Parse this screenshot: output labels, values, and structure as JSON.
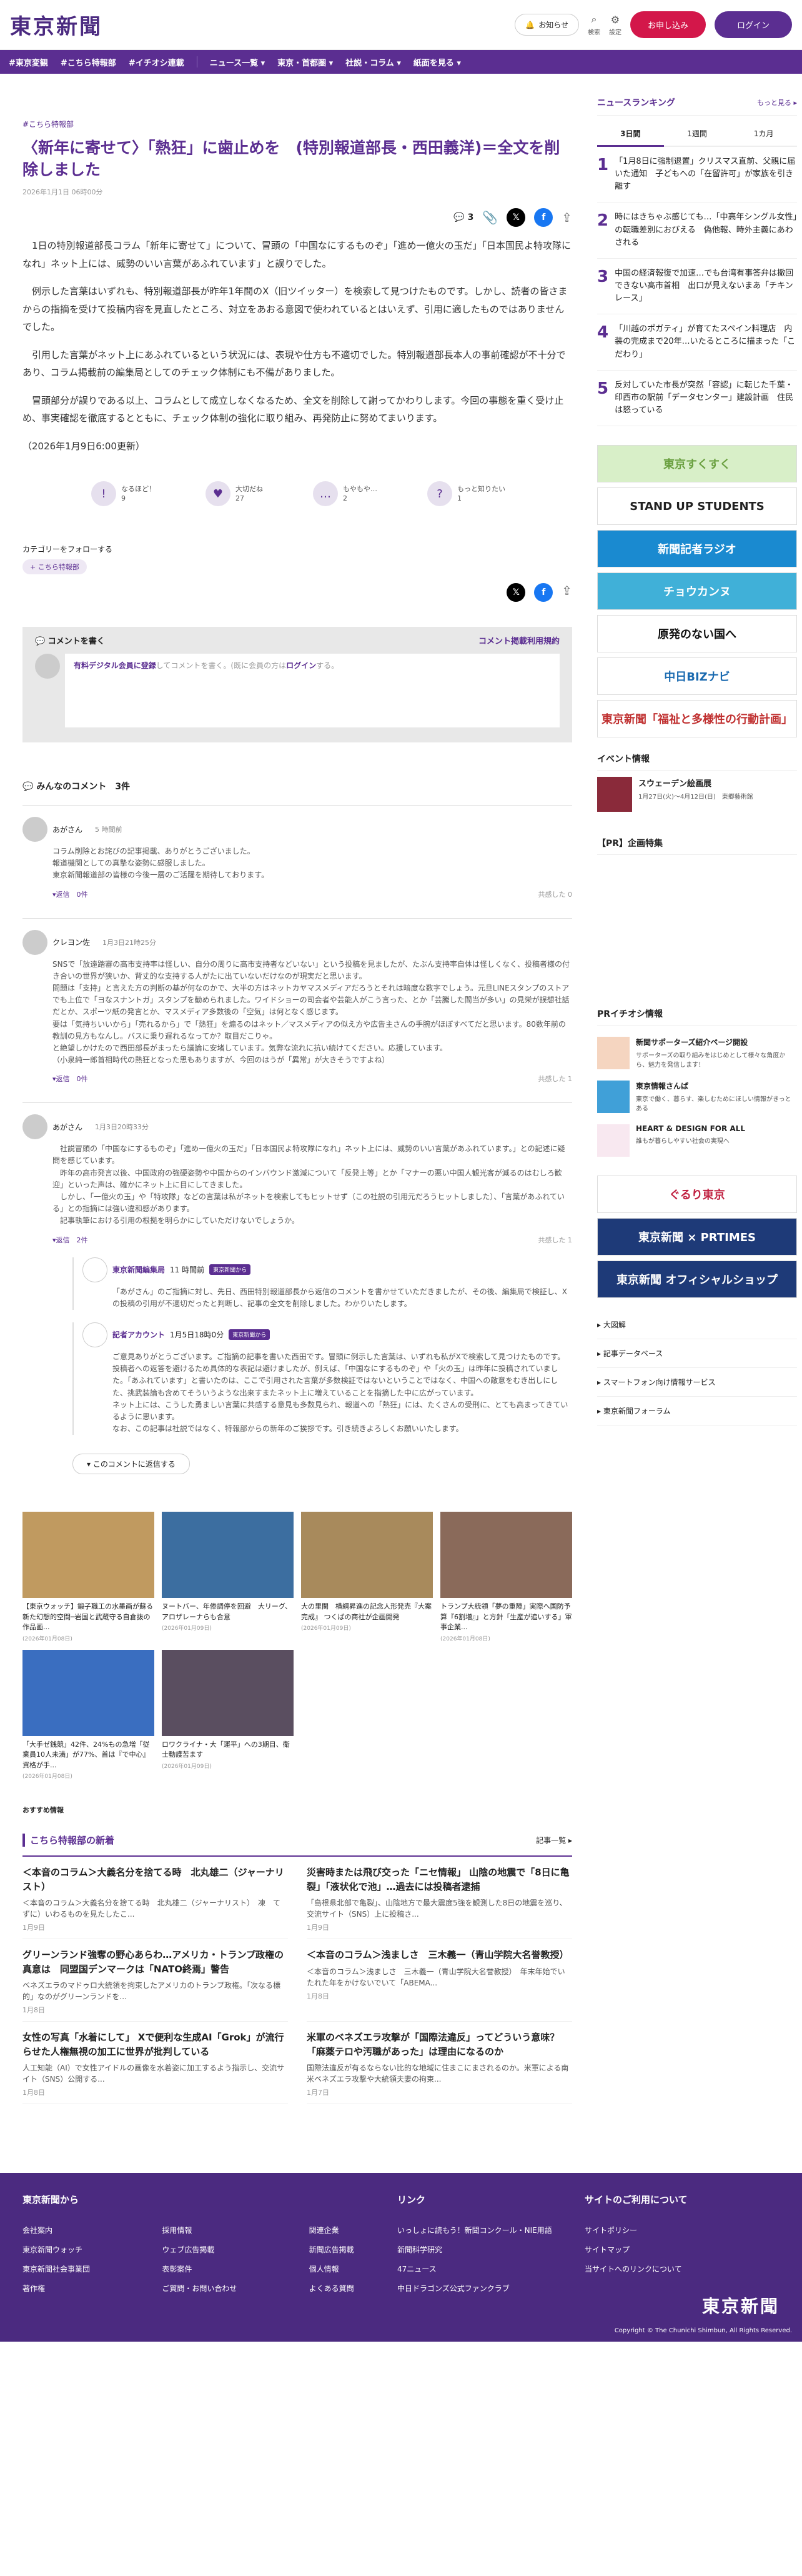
{
  "header": {
    "logo": "東京新聞",
    "notice_label": "お知らせ",
    "search_label": "検索",
    "settings_label": "設定",
    "apply_label": "お申し込み",
    "login_label": "ログイン"
  },
  "nav": [
    "#東京変観",
    "#こちら特報部",
    "#イチオシ連載",
    "ニュース一覧 ▾",
    "東京・首都圏 ▾",
    "社説・コラム ▾",
    "紙面を見る ▾"
  ],
  "article": {
    "breadcrumb": "#こちら特報部",
    "title": "〈新年に寄せて〉「熱狂」に歯止めを　(特別報道部長・西田義洋)＝全文を削除しました",
    "date": "2026年1月1日 06時00分",
    "comment_count": "3",
    "paragraphs": [
      "　1日の特別報道部長コラム「新年に寄せて」について、冒頭の「中国なにするものぞ」「進め一億火の玉だ」「日本国民よ特攻隊になれ」ネット上には、威勢のいい言葉があふれています」と誤りでした。",
      "　例示した言葉はいずれも、特別報道部長が昨年1年間のX（旧ツイッター）を検索して見つけたものです。しかし、読者の皆さまからの指摘を受けて投稿内容を見直したところ、対立をあおる意図で使われているとはいえず、引用に適したものではありませんでした。",
      "　引用した言葉がネット上にあふれているという状況には、表現や仕方も不適切でした。特別報道部長本人の事前確認が不十分であり、コラム掲載前の編集局としてのチェック体制にも不備がありました。",
      "　冒頭部分が誤りである以上、コラムとして成立しなくなるため、全文を削除して謝ってかわりします。今回の事態を重く受け止め、事実確認を徹底するとともに、チェック体制の強化に取り組み、再発防止に努めてまいります。",
      "（2026年1月9日6:00更新）"
    ]
  },
  "reactions": [
    {
      "label": "なるほど！",
      "count": "9"
    },
    {
      "label": "大切だね",
      "count": "27"
    },
    {
      "label": "もやもや…",
      "count": "2"
    },
    {
      "label": "もっと知りたい",
      "count": "1"
    }
  ],
  "category": {
    "heading": "カテゴリーをフォローする",
    "tag": "+ こちら特報部"
  },
  "comment_box": {
    "title": "コメントを書く",
    "policy_link": "コメント掲載利用規約",
    "prompt_link": "有料デジタル会員に登録",
    "prompt_text": "してコメントを書く。(既に会員の方は",
    "login_link": "ログイン",
    "prompt_tail": "する。"
  },
  "comments_header": {
    "title": "みんなのコメント",
    "count": "3件"
  },
  "comments": [
    {
      "name": "あがさん",
      "time": "5 時間前",
      "body": "コラム削除とお詫びの記事掲載、ありがとうございました。\n報道機関としての真摯な姿勢に感服しました。\n東京新聞報道部の皆様の今後一層のご活躍を期待しております。",
      "reply_link": "▾返信　0件",
      "like": "共感した 0"
    },
    {
      "name": "クレヨン佐",
      "time": "1月3日21時25分",
      "body": "SNSで「放遠踏審の高市支持率は怪しい、自分の周りに高市支持者などいない」という投稿を見ましたが、たぶん支持率自体は怪しくなく、投稿者様の付き合いの世界が狭いか、背丈的な支持する人がたに出ていないだけなのが現実だと思います。\n問題は「支持」と言えた方の判断の基が何なのかで、大半の方はネットカヤマスメディアだろうとそれは暗度な数字でしょう。元旦LINEスタンプのストアでも上位で「ヨなスナントガ」スタンプを勧められました。ワイドショーの司会者や芸能人がこう言った、とか「芸騰した間当が多い」の見栄が誤想社話だとか、スポーツ紙の発言とか、マスメディア多数後の「空気」は何となく感じます。\n要は「気持ちいいから」「売れるから」で「熱狂」を煽るのはネット／マスメディアの似え方や広告主さんの手腕がほぼすべてだと思います。80数年前の教訓の見方もなんし。バスに乗り遅れるなってか？取目だこりゃ。\nと絶望しかけたので西田部長がまったら議論に安堵しています。気弊な流れに抗い続けてください。応援しています。\n（小泉純一郎首相時代の熱狂となった思もありますが、今回のはうが「異常」が大きそうですよね）",
      "reply_link": "▾返信　0件",
      "like": "共感した 1"
    },
    {
      "name": "あがさん",
      "time": "1月3日20時33分",
      "body": "　社説冒頭の「中国なにするものぞ」「進め一億火の玉だ」「日本国民よ特攻隊になれ」ネット上には、威勢のいい言葉があふれています。」との記述に疑問を感じています。\n　昨年の高市発言以後、中国政府の強硬姿勢や中国からのインバウンド激減について「反発上等」とか「マナーの悪い中国人観光客が減るのはむしろ歓迎」といった声は、確かにネット上に目にしてきました。\n　しかし、「一億火の玉」や「特攻隊」などの言葉は私がネットを検索してもヒットせず（この社説の引用元だろうヒットしました）、「言葉があふれている」との指摘には強い違和感があります。\n　記事執筆における引用の根拠を明らかにしていただけないでしょうか。",
      "reply_link": "▾返信　2件",
      "like": "共感した 1"
    }
  ],
  "replies": [
    {
      "name": "東京新聞編集局",
      "time": "11 時間前",
      "badge": "東京新聞から",
      "body": "「あがさん」のご指摘に対し、先日、西田特別報道部長から返信のコメントを書かせていただきましたが、その後、編集局で検証し、X の投稿の引用が不適切だったと判断し、記事の全文を削除しました。わかりいたします。"
    },
    {
      "name": "記者アカウント",
      "time": "1月5日18時0分",
      "badge": "東京新聞から",
      "body": "ご意見ありがとうございます。ご指摘の記事を書いた西田です。冒頭に例示した言葉は、いずれも私がXで検索して見つけたものです。投稿者への返答を避けるため具体的な表記は避けましたが、例えば、「中国なにするものぞ」や「火の玉」は昨年に投稿されていました。「あふれています」と書いたのは、ここで引用された言葉が多数検証ではないということではなく、中国への敵意をむき出しにした、挑武装論も含めてそういうような出来すまたネット上に増えていることを指摘した中に広がっています。\nネット上には、こうした勇ましい言葉に共感する意見も多数見られ、報道への「熱狂」には、たくさんの受刑に、とても高まってきているように思います。\nなお、この記事は社説ではなく、特報部からの新年のご挨拶です。引き続きよろしくお願いいたします。"
    }
  ],
  "reply_button": "▾ このコメントに返信する",
  "photo_grid": [
    {
      "title": "【東京ウォッチ】鍛子職工の水墨画が蘇る新た幻想的空間─岩国と武蔵守る自倉抜の作品画...",
      "date": "(2026年01月08日)",
      "color": "#c09a60"
    },
    {
      "title": "ヌートバー、年俸調停を回避　大リーグ、アロザレーナらも合意",
      "date": "(2026年01月09日)",
      "color": "#3c6ea0"
    },
    {
      "title": "大の里関　横綱昇進の記念人形発売『大案完成』 つくばの商社が企画開発",
      "date": "(2026年01月09日)",
      "color": "#a88a5c"
    },
    {
      "title": "トランプ大統領「夢の重陣」実際へ国防予算『6割増』」と方針「生産が追いする」軍事企業...",
      "date": "(2026年01月08日)",
      "color": "#8a6a5a"
    },
    {
      "title": "「大手ゼ銭競」42件、24%もの急増「従業員10人未満」が77%、首は『で中心』資格が手...",
      "date": "(2026年01月08日)",
      "color": "#3a6ec0"
    },
    {
      "title": "ロワクライナ・大「運平」への3期目、衛士動護苦ます",
      "date": "(2026年01月09日)",
      "color": "#5a4e60"
    }
  ],
  "recommend_label": "おすすめ情報",
  "feature": {
    "title": "こちら特報部の新着",
    "more": "記事一覧 ▸",
    "articles": [
      {
        "title": "＜本音のコラム＞大義名分を捨てる時　北丸雄二（ジャーナリスト）",
        "body": "＜本音のコラム＞大義名分を捨てる時　北丸雄二（ジャーナリスト）　凍　てずに）いわるものを見たしたこ...",
        "date": "1月9日"
      },
      {
        "title": "災害時または飛び交った「ニセ情報」 山陰の地震で「8日に亀裂」「液状化で池」…過去には投稿者逮捕",
        "body": "「島根県北部で亀裂」、山陰地方で最大震度5強を観測した8日の地震を巡り、交流サイト（SNS）上に投稿さ...",
        "date": "1月9日"
      },
      {
        "title": "グリーンランド強奪の野心あらわ…アメリカ・トランプ政権の真意は　同盟国デンマークは「NATO終焉」警告",
        "body": "ベネズエラのマドゥロ大統領を拘束したアメリカのトランプ政権。「次なる標的」なのがグリーンランドを...",
        "date": "1月8日"
      },
      {
        "title": "＜本音のコラム＞浅ましさ　三木義一（青山学院大名誉教授）",
        "body": "＜本音のコラム＞浅ましさ　三木義一（青山学院大名誉教授）　年末年始でいたれた年をかけないでいて「ABEMA...",
        "date": "1月8日"
      },
      {
        "title": "女性の写真「水着にして」 Xで便利な生成AI「Grok」が流行らせた人権無視の加工に世界が批判している",
        "body": "人工知能（AI）で女性アイドルの画像を水着姿に加工するよう指示し、交流サイト（SNS）公開する...",
        "date": "1月8日"
      },
      {
        "title": "米軍のベネズエラ攻撃が「国際法違反」ってどういう意味？「麻薬テロや汚職があった」は理由になるのか",
        "body": "国際法違反が有るならない比的な地域に住まこにまされるのか。米軍による南米ベネズエラ攻撃や大統領夫妻の拘束...",
        "date": "1月7日"
      }
    ]
  },
  "sidebar": {
    "ranking_title": "ニュースランキング",
    "ranking_more": "もっと見る ▸",
    "tabs": [
      "3日間",
      "1週間",
      "1カ月"
    ],
    "ranking": [
      {
        "n": "1",
        "t": "「1月8日に強制退置」クリスマス直前、父親に届いた通知　子どもへの「在留許可」が家族を引き離す"
      },
      {
        "n": "2",
        "t": "時にはきちゃぶ感じても…「中高年シングル女性」の転職差別におびえる　偽他報、時外主義にあわされる"
      },
      {
        "n": "3",
        "t": "中国の経済報復で加速…でも台湾有事答弁は撤回できない高市首相　出口が見えないまあ「チキンレース」"
      },
      {
        "n": "4",
        "t": "「川越のポガティ」が育てたスペイン料理店　内装の完成まで20年…いたるところに描まった「こだわり」"
      },
      {
        "n": "5",
        "t": "反対していた市長が突然「容認」に転じた千葉・印西市の駅前「データセンター」建設計画　住民は怒っている"
      }
    ],
    "banners": [
      {
        "text": "東京すくすく",
        "bg": "#d8efc8",
        "fg": "#6aa040"
      },
      {
        "text": "STAND UP STUDENTS",
        "bg": "#ffffff",
        "fg": "#222"
      },
      {
        "text": "新聞記者ラジオ",
        "bg": "#1a8ad0",
        "fg": "#fff"
      },
      {
        "text": "チョウカンヌ",
        "bg": "#40b0d8",
        "fg": "#fff"
      },
      {
        "text": "原発のない国へ",
        "bg": "#ffffff",
        "fg": "#111"
      },
      {
        "text": "中日BIZナビ",
        "bg": "#ffffff",
        "fg": "#1a6ab0"
      },
      {
        "text": "東京新聞「福祉と多様性の行動計画」",
        "bg": "#ffffff",
        "fg": "#c03030"
      }
    ],
    "event_title": "イベント情報",
    "event": {
      "name": "スウェーデン絵画展",
      "detail": "1月27日(火)〜4月12日(日)　東郷藝術館"
    },
    "pr_title": "【PR】企画特集",
    "pr_ichioshi": "PRイチオシ情報",
    "pr_items": [
      {
        "t": "新聞サポーターズ紹介ページ開設",
        "s": "サポーターズの取り組みをはじめとして様々な角度から、魅力を発信します！",
        "c": "#f5d5c0"
      },
      {
        "t": "東京情報さんぱ",
        "s": "東京で働く、暮らす、楽しむためにほしい情報がきっとある",
        "c": "#40a0d8"
      },
      {
        "t": "HEART & DESIGN FOR ALL",
        "s": "誰もが暮らしやすい社会の実現へ",
        "c": "#f8e8f0"
      }
    ],
    "banners2": [
      {
        "text": "ぐるり東京",
        "bg": "#ffffff",
        "fg": "#c02040"
      },
      {
        "text": "東京新聞 × PRTIMES",
        "bg": "#1e3a78",
        "fg": "#fff"
      },
      {
        "text": "東京新聞 オフィシャルショップ",
        "bg": "#1e3a78",
        "fg": "#fff"
      }
    ],
    "links": [
      "大図解",
      "記事データベース",
      "スマートフォン向け情報サービス",
      "東京新聞フォーラム"
    ]
  },
  "footer": {
    "cols": [
      {
        "title": "東京新聞から",
        "links": [
          "会社案内",
          "採用情報",
          "関連企業",
          "東京新聞ウォッチ",
          "ウェブ広告掲載",
          "新聞広告掲載",
          "東京新聞社会事業団",
          "表彰案件",
          "個人情報",
          "著作権",
          "ご質問・お問い合わせ",
          "よくある質問"
        ]
      },
      {
        "title": "リンク",
        "links": [
          "いっしょに読もう！新聞コンクール・NIE用語",
          "新聞科学研究",
          "47ニュース",
          "中日ドラゴンズ公式ファンクラブ"
        ]
      },
      {
        "title": "サイトのご利用について",
        "links": [
          "サイトポリシー",
          "サイトマップ",
          "当サイトへのリンクについて"
        ]
      }
    ],
    "logo": "東京新聞",
    "copyright": "Copyright © The Chunichi Shimbun, All Rights Reserved."
  }
}
